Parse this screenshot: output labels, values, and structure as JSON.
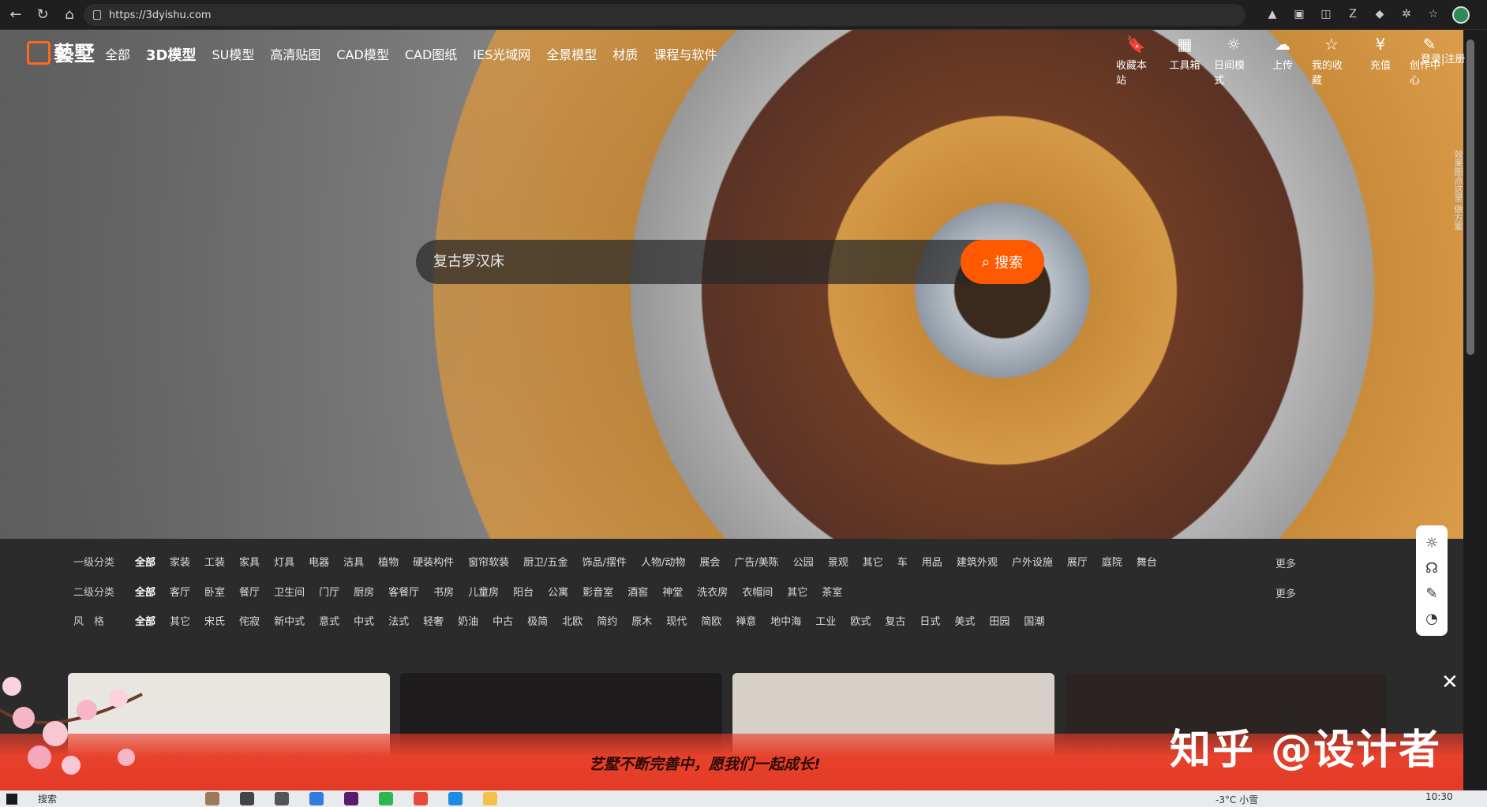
{
  "browser": {
    "url": "https://3dyishu.com"
  },
  "site": {
    "logo_text": "藝墅",
    "nav": [
      "全部",
      "3D模型",
      "SU模型",
      "高清贴图",
      "CAD模型",
      "CAD图纸",
      "IES光域网",
      "全景模型",
      "材质",
      "课程与软件"
    ],
    "tools": [
      {
        "label": "收藏本站",
        "icon": "bookmark-icon"
      },
      {
        "label": "工具箱",
        "icon": "grid-icon"
      },
      {
        "label": "日间模式",
        "icon": "sun-icon"
      },
      {
        "label": "上传",
        "icon": "cloud-upload-icon"
      },
      {
        "label": "我的收藏",
        "icon": "star-icon"
      },
      {
        "label": "充值",
        "icon": "yen-icon"
      },
      {
        "label": "创作中心",
        "icon": "feather-icon"
      }
    ],
    "login": "登录|注册",
    "side_text": "效果图点这里  做方案"
  },
  "search": {
    "value": "复古罗汉床",
    "button": "搜索"
  },
  "filters": {
    "row1": {
      "label": "一级分类",
      "items": [
        "全部",
        "家装",
        "工装",
        "家具",
        "灯具",
        "电器",
        "洁具",
        "植物",
        "硬装构件",
        "窗帘软装",
        "厨卫/五金",
        "饰品/摆件",
        "人物/动物",
        "展会",
        "广告/美陈",
        "公园",
        "景观",
        "其它",
        "车",
        "用品",
        "建筑外观",
        "户外设施",
        "展厅",
        "庭院",
        "舞台"
      ],
      "more": "更多"
    },
    "row2": {
      "label": "二级分类",
      "items": [
        "全部",
        "客厅",
        "卧室",
        "餐厅",
        "卫生间",
        "门厅",
        "厨房",
        "客餐厅",
        "书房",
        "儿童房",
        "阳台",
        "公寓",
        "影音室",
        "酒窖",
        "神堂",
        "洗衣房",
        "衣帽间",
        "其它",
        "茶室"
      ],
      "more": "更多"
    },
    "row3": {
      "label": "风　格",
      "items": [
        "全部",
        "其它",
        "宋氏",
        "侘寂",
        "新中式",
        "意式",
        "中式",
        "法式",
        "轻奢",
        "奶油",
        "中古",
        "极简",
        "北欧",
        "简约",
        "原木",
        "现代",
        "简欧",
        "禅意",
        "地中海",
        "工业",
        "欧式",
        "复古",
        "日式",
        "美式",
        "田园",
        "国潮"
      ]
    }
  },
  "banner": {
    "text": "艺墅不断完善中，愿我们一起成长!",
    "watermark": "知乎 @设计者"
  },
  "taskbar": {
    "search": "搜索",
    "weather": "-3°C 小雪",
    "time": "10:30"
  },
  "colors": {
    "accent": "#ff5a00",
    "banner": "#e8412c"
  }
}
